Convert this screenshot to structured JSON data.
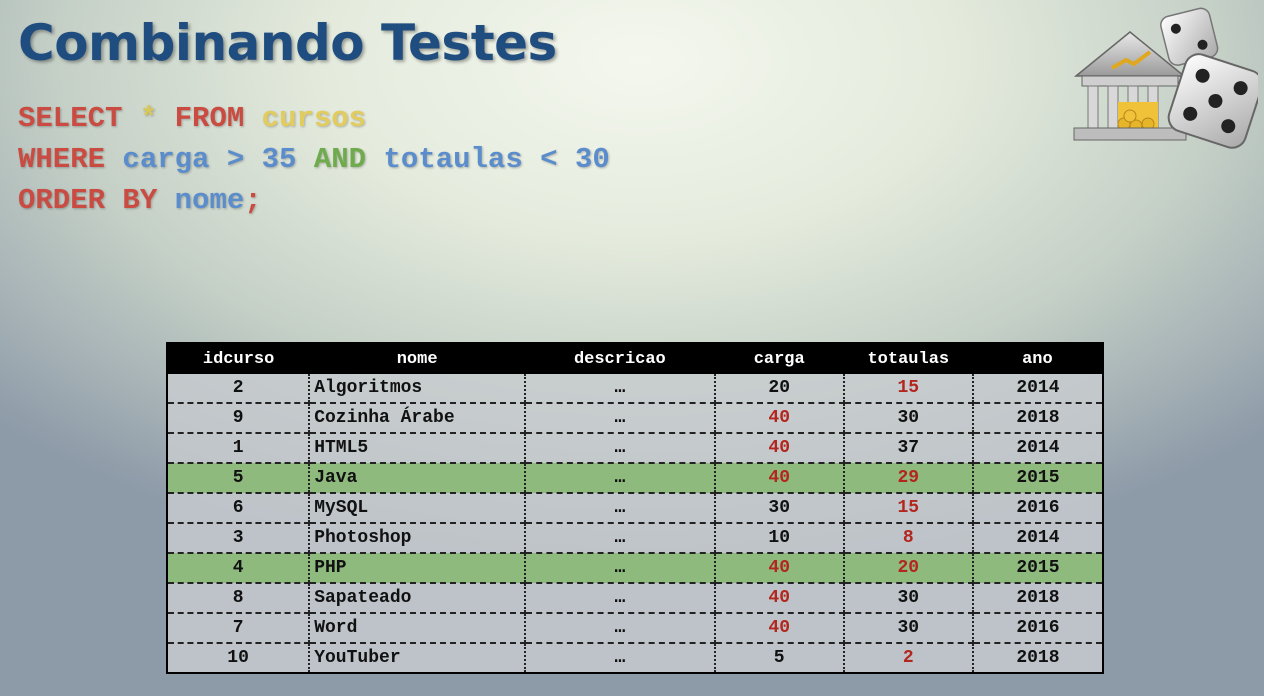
{
  "title": "Combinando Testes",
  "sql": {
    "line1": {
      "select": "SELECT",
      "star": "*",
      "from": "FROM",
      "table": "cursos"
    },
    "line2": {
      "where": "WHERE",
      "col1": "carga",
      "op1": ">",
      "val1": "35",
      "and": "AND",
      "col2": "totaulas",
      "op2": "<",
      "val2": "30"
    },
    "line3": {
      "order_by": "ORDER BY",
      "col": "nome",
      "semicolon": ";"
    }
  },
  "colors": {
    "title": "#1f4d7f",
    "keyword": "#c94b41",
    "table": "#e2cc5e",
    "column": "#5b8ccc",
    "and": "#6fab4c",
    "highlight": "#8fba7e",
    "value_red": "#b3261e"
  },
  "logo": {
    "icon": "bank-and-dice-icon"
  },
  "table": {
    "headers": [
      "idcurso",
      "nome",
      "descricao",
      "carga",
      "totaulas",
      "ano"
    ],
    "rows": [
      {
        "idcurso": "2",
        "nome": "Algoritmos",
        "descricao": "…",
        "carga": "20",
        "totaulas": "15",
        "ano": "2014"
      },
      {
        "idcurso": "9",
        "nome": "Cozinha Árabe",
        "descricao": "…",
        "carga": "40",
        "totaulas": "30",
        "ano": "2018"
      },
      {
        "idcurso": "1",
        "nome": "HTML5",
        "descricao": "…",
        "carga": "40",
        "totaulas": "37",
        "ano": "2014"
      },
      {
        "idcurso": "5",
        "nome": "Java",
        "descricao": "…",
        "carga": "40",
        "totaulas": "29",
        "ano": "2015"
      },
      {
        "idcurso": "6",
        "nome": "MySQL",
        "descricao": "…",
        "carga": "30",
        "totaulas": "15",
        "ano": "2016"
      },
      {
        "idcurso": "3",
        "nome": "Photoshop",
        "descricao": "…",
        "carga": "10",
        "totaulas": "8",
        "ano": "2014"
      },
      {
        "idcurso": "4",
        "nome": "PHP",
        "descricao": "…",
        "carga": "40",
        "totaulas": "20",
        "ano": "2015"
      },
      {
        "idcurso": "8",
        "nome": "Sapateado",
        "descricao": "…",
        "carga": "40",
        "totaulas": "30",
        "ano": "2018"
      },
      {
        "idcurso": "7",
        "nome": "Word",
        "descricao": "…",
        "carga": "40",
        "totaulas": "30",
        "ano": "2016"
      },
      {
        "idcurso": "10",
        "nome": "YouTuber",
        "descricao": "…",
        "carga": "5",
        "totaulas": "2",
        "ano": "2018"
      }
    ]
  }
}
